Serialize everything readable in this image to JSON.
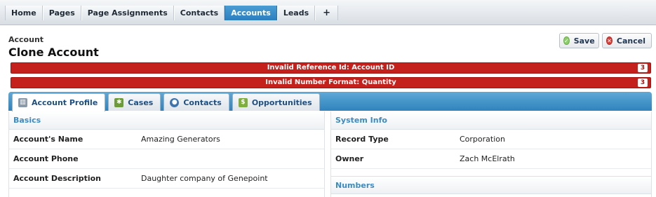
{
  "nav": {
    "items": [
      {
        "label": "Home",
        "active": false
      },
      {
        "label": "Pages",
        "active": false
      },
      {
        "label": "Page Assignments",
        "active": false
      },
      {
        "label": "Contacts",
        "active": false
      },
      {
        "label": "Accounts",
        "active": true
      },
      {
        "label": "Leads",
        "active": false
      }
    ],
    "add_label": "+"
  },
  "header": {
    "breadcrumb": "Account",
    "title": "Clone Account",
    "save_label": "Save",
    "cancel_label": "Cancel"
  },
  "errors": [
    {
      "message": "Invalid Reference Id: Account ID",
      "count": "3"
    },
    {
      "message": "Invalid Number Format: Quantity",
      "count": "3"
    }
  ],
  "tabs": [
    {
      "label": "Account Profile",
      "icon": "building-icon",
      "active": true
    },
    {
      "label": "Cases",
      "icon": "cases-icon",
      "active": false
    },
    {
      "label": "Contacts",
      "icon": "person-icon",
      "active": false
    },
    {
      "label": "Opportunities",
      "icon": "money-icon",
      "active": false
    }
  ],
  "basics": {
    "heading": "Basics",
    "fields": [
      {
        "label": "Account's Name",
        "value": "Amazing Generators"
      },
      {
        "label": "Account Phone",
        "value": ""
      },
      {
        "label": "Account Description",
        "value": "Daughter company of Genepoint"
      }
    ]
  },
  "system_info": {
    "heading": "System Info",
    "fields": [
      {
        "label": "Record Type",
        "value": "Corporation"
      },
      {
        "label": "Owner",
        "value": "Zach McElrath"
      }
    ]
  },
  "numbers": {
    "heading": "Numbers"
  },
  "colors": {
    "accent": "#2f83bd",
    "error": "#c4211d",
    "section_heading": "#3d8bc0"
  }
}
